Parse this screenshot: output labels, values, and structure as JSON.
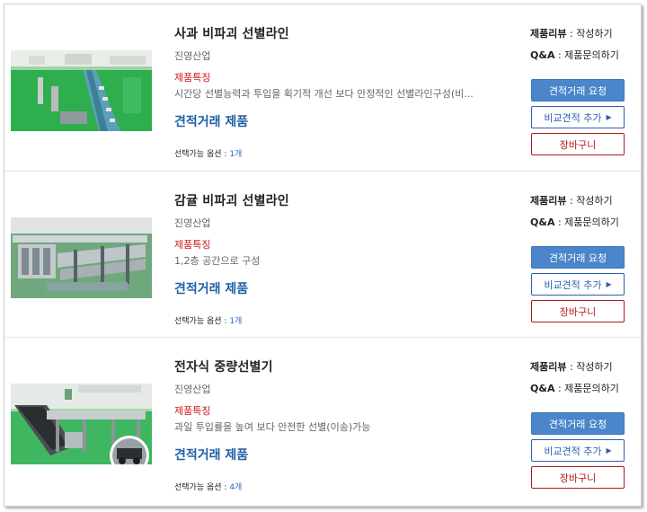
{
  "review_label": "제품리뷰",
  "review_action": "작성하기",
  "qa_label": "Q&A",
  "qa_action": "제품문의하기",
  "request_button": "견적거래 요청",
  "compare_button": "비교견적 추가",
  "cart_button": "장바구니",
  "options_label": "선택가능 옵션 :",
  "feature_label": "제품특징",
  "quote_link": "견적거래 제품",
  "products": [
    {
      "title": "사과 비파괴 선별라인",
      "company": "진영산업",
      "feature": "시간당 선별능력과 투입을 획기적 개선 보다 안정적인 선별라인구성(비...",
      "option_count": "1개"
    },
    {
      "title": "감귤 비파괴 선별라인",
      "company": "진영산업",
      "feature": "1,2층 공간으로 구성",
      "option_count": "1개"
    },
    {
      "title": "전자식 중량선별기",
      "company": "진영산업",
      "feature": "과일 투입률을 높여 보다 안전한 선별(이송)가능",
      "option_count": "4개"
    }
  ]
}
